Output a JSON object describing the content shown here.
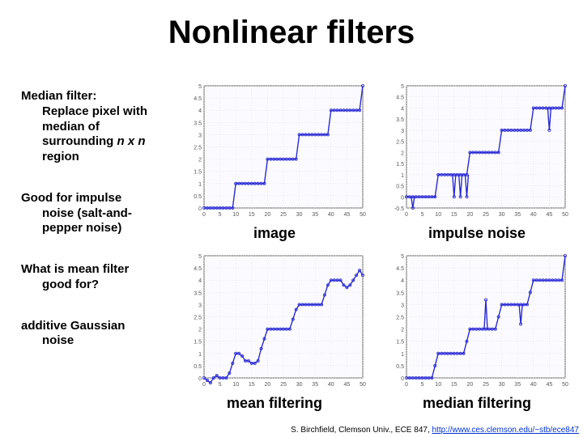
{
  "title": "Nonlinear filters",
  "text": {
    "median_head": "Median filter:",
    "median_body1": "Replace pixel with",
    "median_body2": "median of",
    "median_body3a": "surrounding ",
    "median_body3b": "n x n",
    "median_body4": "region",
    "good_line1": "Good for impulse",
    "good_line2": "noise (salt-and-",
    "good_line3": "pepper noise)",
    "q_line1": "What is mean filter",
    "q_line2": "good for?",
    "gauss_line1": "additive Gaussian",
    "gauss_line2": "noise"
  },
  "captions": {
    "c00": "image",
    "c01": "impulse noise",
    "c10": "mean filtering",
    "c11": "median filtering"
  },
  "footer": {
    "prefix": "S. Birchfield, Clemson Univ., ECE 847, ",
    "link": "http://www.ces.clemson.edu/~stb/ece847"
  },
  "chart_data": [
    {
      "type": "line",
      "title": "image",
      "xlabel": "",
      "ylabel": "",
      "xlim": [
        0,
        50
      ],
      "ylim": [
        0,
        5
      ],
      "xticks": [
        0,
        5,
        10,
        15,
        20,
        25,
        30,
        35,
        40,
        45,
        50
      ],
      "yticks": [
        0,
        0.5,
        1,
        1.5,
        2,
        2.5,
        3,
        3.5,
        4,
        4.5,
        5
      ],
      "series": [
        {
          "name": "signal",
          "x": [
            0,
            1,
            2,
            3,
            4,
            5,
            6,
            7,
            8,
            9,
            10,
            11,
            12,
            13,
            14,
            15,
            16,
            17,
            18,
            19,
            20,
            21,
            22,
            23,
            24,
            25,
            26,
            27,
            28,
            29,
            30,
            31,
            32,
            33,
            34,
            35,
            36,
            37,
            38,
            39,
            40,
            41,
            42,
            43,
            44,
            45,
            46,
            47,
            48,
            49,
            50
          ],
          "values": [
            0,
            0,
            0,
            0,
            0,
            0,
            0,
            0,
            0,
            0,
            1,
            1,
            1,
            1,
            1,
            1,
            1,
            1,
            1,
            1,
            2,
            2,
            2,
            2,
            2,
            2,
            2,
            2,
            2,
            2,
            3,
            3,
            3,
            3,
            3,
            3,
            3,
            3,
            3,
            3,
            4,
            4,
            4,
            4,
            4,
            4,
            4,
            4,
            4,
            4,
            5
          ]
        }
      ]
    },
    {
      "type": "line",
      "title": "impulse noise",
      "xlabel": "",
      "ylabel": "",
      "xlim": [
        0,
        50
      ],
      "ylim": [
        -0.5,
        5
      ],
      "xticks": [
        0,
        5,
        10,
        15,
        20,
        25,
        30,
        35,
        40,
        45,
        50
      ],
      "yticks": [
        -0.5,
        0,
        0.5,
        1,
        1.5,
        2,
        2.5,
        3,
        3.5,
        4,
        4.5,
        5
      ],
      "series": [
        {
          "name": "signal",
          "x": [
            0,
            1,
            2,
            3,
            4,
            5,
            6,
            7,
            8,
            9,
            10,
            11,
            12,
            13,
            14,
            15,
            16,
            17,
            18,
            19,
            20,
            21,
            22,
            23,
            24,
            25,
            26,
            27,
            28,
            29,
            30,
            31,
            32,
            33,
            34,
            35,
            36,
            37,
            38,
            39,
            40,
            41,
            42,
            43,
            44,
            45,
            46,
            47,
            48,
            49,
            50
          ],
          "values": [
            0,
            0,
            0,
            0,
            0,
            0,
            0,
            0,
            0,
            0,
            1,
            1,
            1,
            1,
            1,
            1,
            1,
            1,
            1,
            1,
            2,
            2,
            2,
            2,
            2,
            2,
            2,
            2,
            2,
            2,
            3,
            3,
            3,
            3,
            3,
            3,
            3,
            3,
            3,
            3,
            4,
            4,
            4,
            4,
            4,
            4,
            4,
            4,
            4,
            4,
            5
          ]
        },
        {
          "name": "spikes",
          "x": [
            2,
            15,
            17,
            19,
            45
          ],
          "values": [
            -0.5,
            0,
            0,
            0,
            3
          ]
        }
      ]
    },
    {
      "type": "line",
      "title": "mean filtering",
      "xlabel": "",
      "ylabel": "",
      "xlim": [
        0,
        50
      ],
      "ylim": [
        0,
        5
      ],
      "xticks": [
        0,
        5,
        10,
        15,
        20,
        25,
        30,
        35,
        40,
        45,
        50
      ],
      "yticks": [
        0,
        0.5,
        1,
        1.5,
        2,
        2.5,
        3,
        3.5,
        4,
        4.5,
        5
      ],
      "series": [
        {
          "name": "signal",
          "x": [
            0,
            1,
            2,
            3,
            4,
            5,
            6,
            7,
            8,
            9,
            10,
            11,
            12,
            13,
            14,
            15,
            16,
            17,
            18,
            19,
            20,
            21,
            22,
            23,
            24,
            25,
            26,
            27,
            28,
            29,
            30,
            31,
            32,
            33,
            34,
            35,
            36,
            37,
            38,
            39,
            40,
            41,
            42,
            43,
            44,
            45,
            46,
            47,
            48,
            49,
            50
          ],
          "values": [
            0,
            -0.1,
            -0.2,
            0,
            0.1,
            0,
            0,
            0,
            0.2,
            0.6,
            1.0,
            1.0,
            0.9,
            0.7,
            0.7,
            0.6,
            0.6,
            0.7,
            1.2,
            1.6,
            2.0,
            2.0,
            2.0,
            2.0,
            2.0,
            2.0,
            2.0,
            2.0,
            2.4,
            2.8,
            3.0,
            3.0,
            3.0,
            3.0,
            3.0,
            3.0,
            3.0,
            3.0,
            3.4,
            3.8,
            4.0,
            4.0,
            4.0,
            4.0,
            3.8,
            3.7,
            3.8,
            4.0,
            4.2,
            4.4,
            4.2
          ]
        }
      ]
    },
    {
      "type": "line",
      "title": "median filtering",
      "xlabel": "",
      "ylabel": "",
      "xlim": [
        0,
        50
      ],
      "ylim": [
        0,
        5
      ],
      "xticks": [
        0,
        5,
        10,
        15,
        20,
        25,
        30,
        35,
        40,
        45,
        50
      ],
      "yticks": [
        0,
        0.5,
        1,
        1.5,
        2,
        2.5,
        3,
        3.5,
        4,
        4.5,
        5
      ],
      "series": [
        {
          "name": "signal",
          "x": [
            0,
            1,
            2,
            3,
            4,
            5,
            6,
            7,
            8,
            9,
            10,
            11,
            12,
            13,
            14,
            15,
            16,
            17,
            18,
            19,
            20,
            21,
            22,
            23,
            24,
            25,
            26,
            27,
            28,
            29,
            30,
            31,
            32,
            33,
            34,
            35,
            36,
            37,
            38,
            39,
            40,
            41,
            42,
            43,
            44,
            45,
            46,
            47,
            48,
            49,
            50
          ],
          "values": [
            0,
            0,
            0,
            0,
            0,
            0,
            0,
            0,
            0,
            0.5,
            1,
            1,
            1,
            1,
            1,
            1,
            1,
            1,
            1,
            1.5,
            2,
            2,
            2,
            2,
            2,
            2,
            2,
            2,
            2,
            2.5,
            3,
            3,
            3,
            3,
            3,
            3,
            3,
            3,
            3,
            3.5,
            4,
            4,
            4,
            4,
            4,
            4,
            4,
            4,
            4,
            4,
            5
          ]
        },
        {
          "name": "spikes",
          "x": [
            25,
            36
          ],
          "values": [
            3.2,
            2.2
          ]
        }
      ]
    }
  ],
  "colors": {
    "plot_line": "#2a2ad4",
    "grid": "#d8d8e0",
    "bg": "#fbfbff",
    "tick": "#555"
  }
}
